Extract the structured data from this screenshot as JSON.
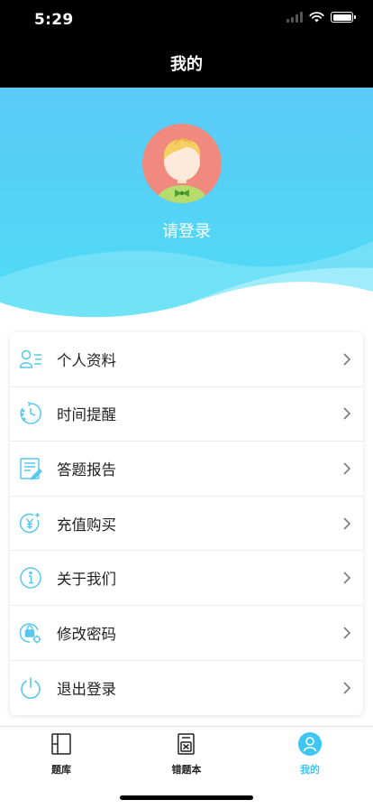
{
  "status_bar": {
    "time": "5:29"
  },
  "header": {
    "title": "我的"
  },
  "profile": {
    "login_prompt": "请登录"
  },
  "menu": {
    "items": [
      {
        "label": "个人资料",
        "icon": "person-list-icon"
      },
      {
        "label": "时间提醒",
        "icon": "clock-refresh-icon"
      },
      {
        "label": "答题报告",
        "icon": "report-edit-icon"
      },
      {
        "label": "充值购买",
        "icon": "yen-coin-icon"
      },
      {
        "label": "关于我们",
        "icon": "info-icon"
      },
      {
        "label": "修改密码",
        "icon": "lock-gear-icon"
      },
      {
        "label": "退出登录",
        "icon": "power-icon"
      }
    ]
  },
  "tabs": [
    {
      "label": "题库",
      "icon": "book-icon",
      "active": false
    },
    {
      "label": "错题本",
      "icon": "wrong-book-icon",
      "active": false
    },
    {
      "label": "我的",
      "icon": "person-circle-icon",
      "active": true
    }
  ],
  "colors": {
    "accent": "#3ec6f2",
    "hero_top": "#5bcaf8",
    "hero_bottom": "#4ddff5",
    "avatar_bg": "#f0897e"
  }
}
